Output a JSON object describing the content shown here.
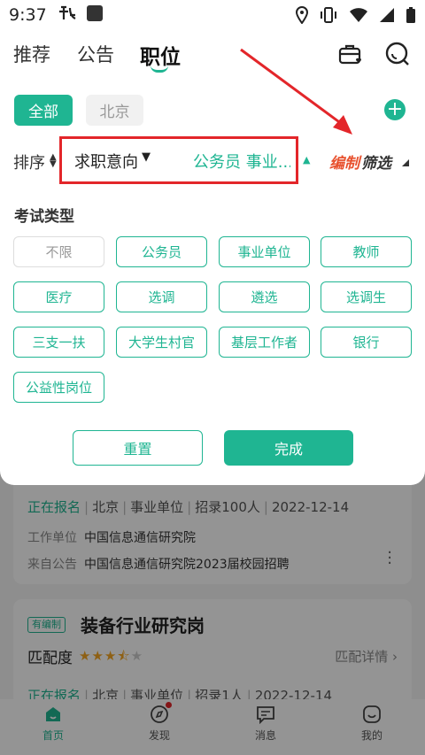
{
  "status": {
    "time": "9:37"
  },
  "header": {
    "tabs": [
      {
        "label": "推荐",
        "active": false
      },
      {
        "label": "公告",
        "active": false
      },
      {
        "label": "职位",
        "active": true
      }
    ]
  },
  "filter": {
    "cities": {
      "all": "全部",
      "beijing": "北京"
    },
    "sort_label": "排序",
    "intent_label": "求职意向",
    "intent_value": "公务员 事业...",
    "bianzhi": "编制",
    "shaixuan": "筛选",
    "section_title": "考试类型",
    "exam_types": [
      "不限",
      "公务员",
      "事业单位",
      "教师",
      "医疗",
      "选调",
      "遴选",
      "选调生",
      "三支一扶",
      "大学生村官",
      "基层工作者",
      "银行",
      "公益性岗位"
    ],
    "reset_label": "重置",
    "done_label": "完成"
  },
  "list": {
    "card1": {
      "status": "正在报名",
      "location": "北京",
      "type": "事业单位",
      "recruit": "招录100人",
      "date": "2022-12-14",
      "employer_key": "工作单位",
      "employer_value": "中国信息通信研究院",
      "source_key": "来自公告",
      "source_value": "中国信息通信研究院2023届校园招聘"
    },
    "card2": {
      "tag": "有编制",
      "title": "装备行业研究岗",
      "match_label": "匹配度",
      "match_detail": "匹配详情 ›",
      "rating": 3.5,
      "status": "正在报名",
      "location": "北京",
      "type": "事业单位",
      "recruit": "招录1人",
      "date": "2022-12-14"
    }
  },
  "bottom_nav": [
    {
      "label": "首页",
      "icon": "home-icon"
    },
    {
      "label": "发现",
      "icon": "compass-icon"
    },
    {
      "label": "消息",
      "icon": "message-icon"
    },
    {
      "label": "我的",
      "icon": "profile-icon"
    }
  ],
  "colors": {
    "accent": "#1fb592",
    "annotation": "#e3262a",
    "bianzhi": "#e8522f"
  }
}
